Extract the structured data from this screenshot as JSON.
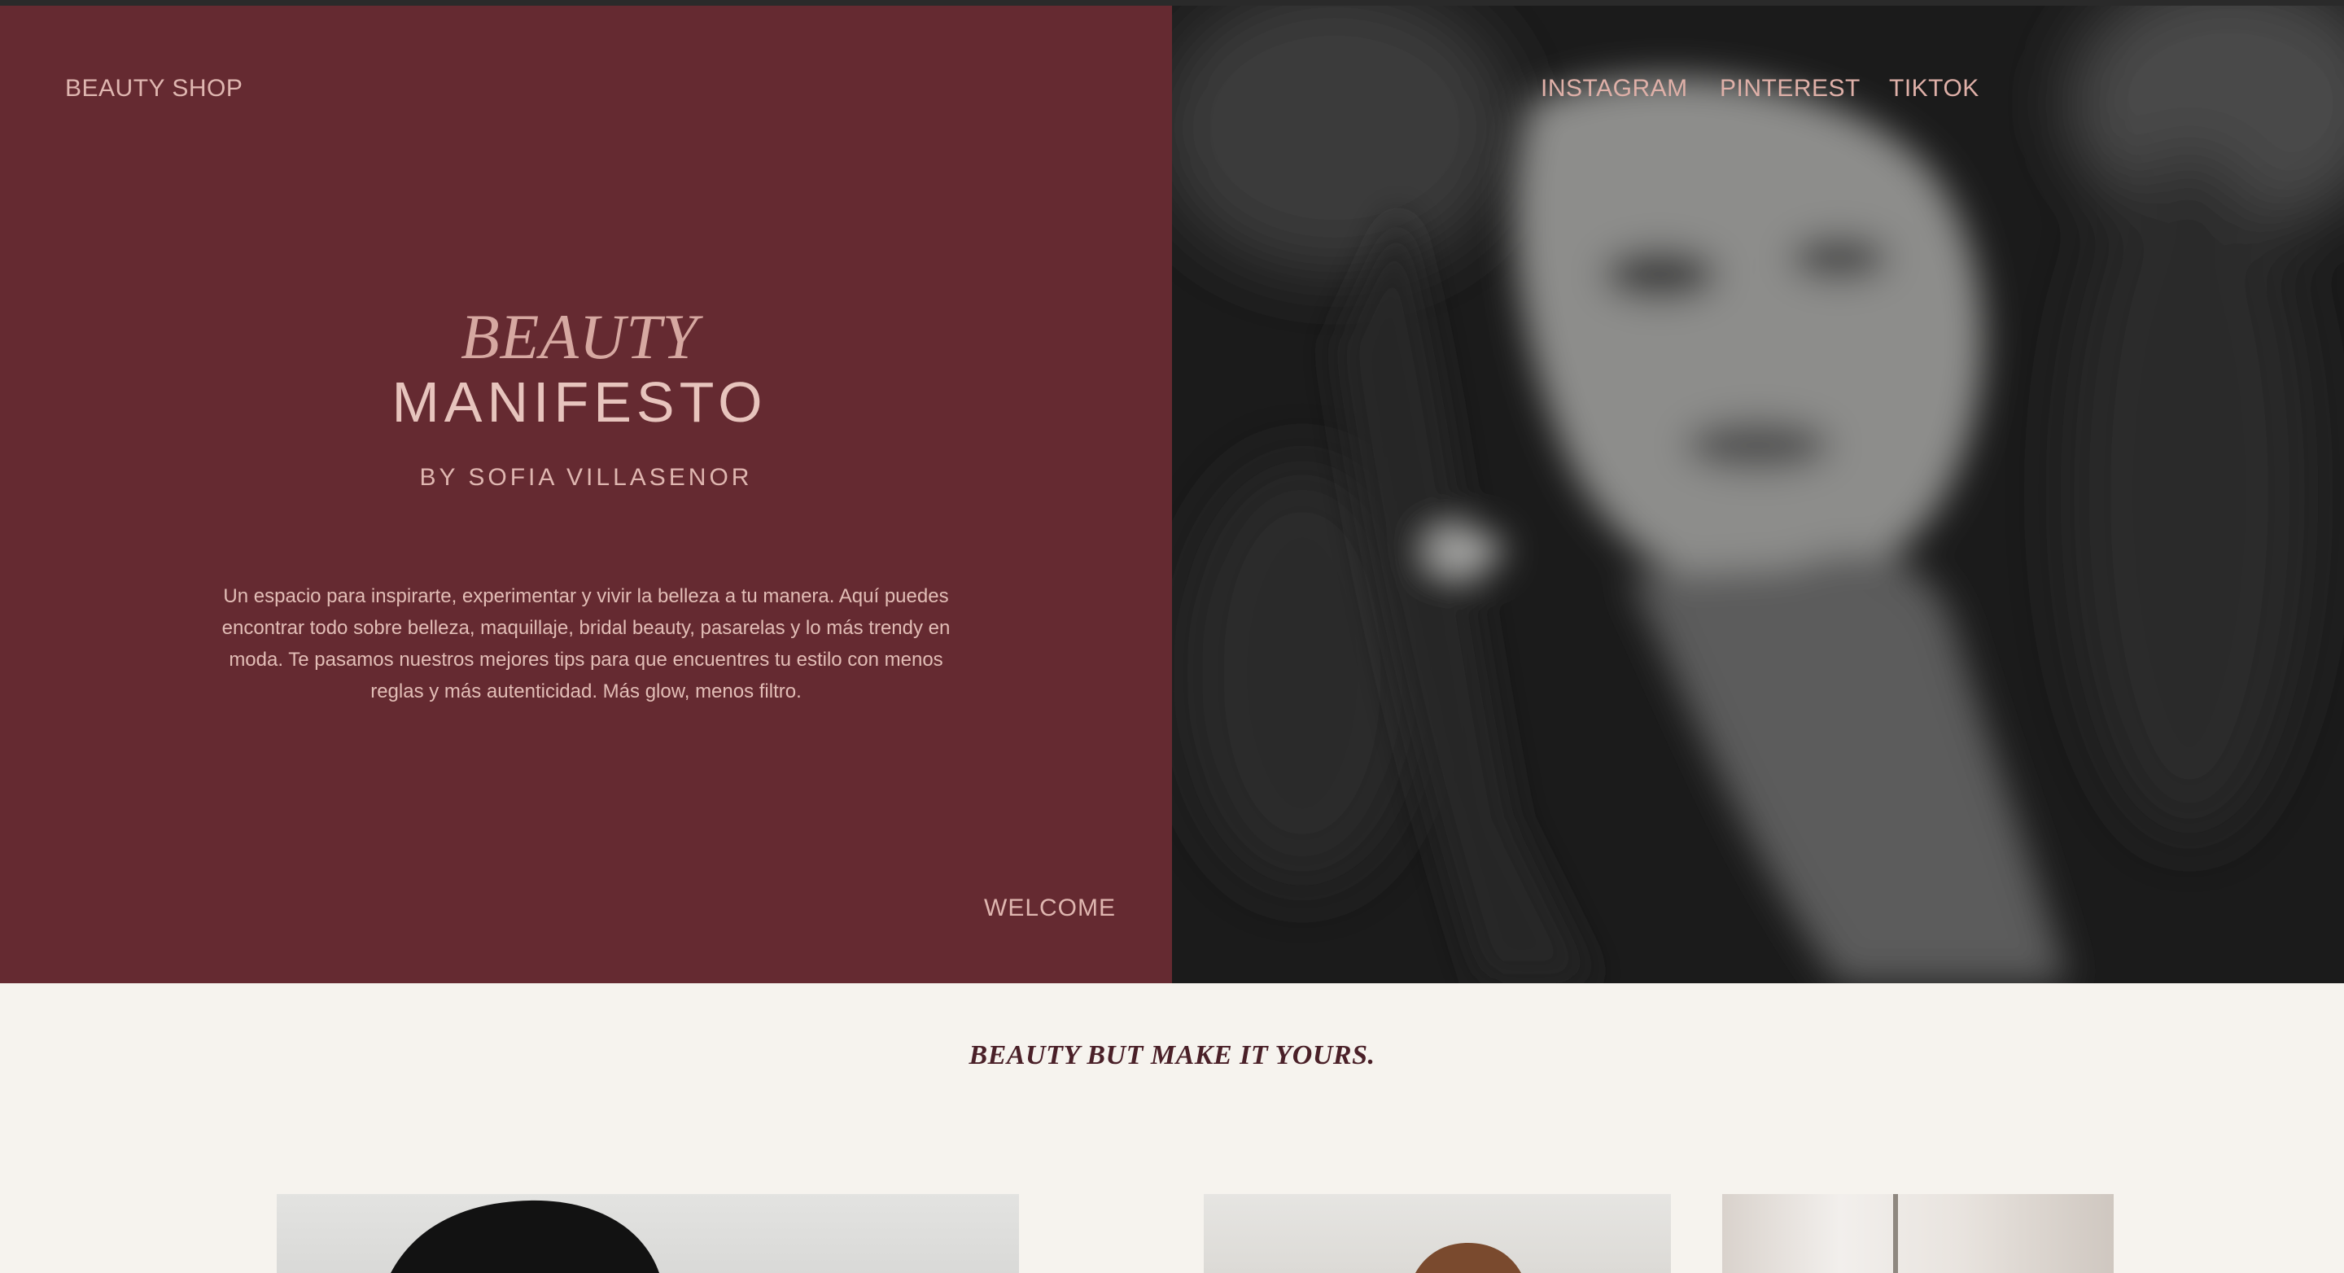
{
  "header": {
    "brand": "BEAUTY SHOP",
    "social_links": [
      "INSTAGRAM",
      "PINTEREST",
      "TIKTOK"
    ]
  },
  "hero": {
    "title_script": "BEAUTY",
    "title_main": "MANIFESTO",
    "byline": "BY SOFIA VILLASENOR",
    "intro": "Un espacio para inspirarte, experimentar y vivir la belleza a tu manera. Aquí puedes encontrar todo sobre belleza, maquillaje, bridal beauty, pasarelas y lo más trendy en moda. Te pasamos nuestros mejores tips para que encuentres tu estilo con menos reglas y más autenticidad. Más glow, menos filtro.",
    "welcome": "WELCOME"
  },
  "section": {
    "tagline": "BEAUTY BUT MAKE IT YOURS."
  },
  "colors": {
    "hero_background": "#652a31",
    "page_background": "#f6f3ee",
    "accent_text": "#dfb6b0",
    "tagline_text": "#4a2028"
  }
}
